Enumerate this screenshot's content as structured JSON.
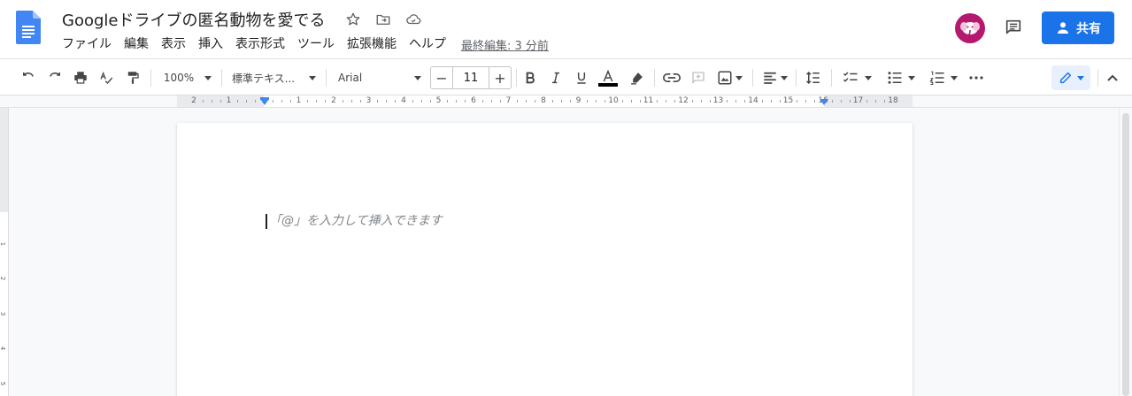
{
  "header": {
    "doc_title": "Googleドライブの匿名動物を愛でる",
    "menu": [
      "ファイル",
      "編集",
      "表示",
      "挿入",
      "表示形式",
      "ツール",
      "拡張機能",
      "ヘルプ"
    ],
    "last_edit": "最終編集: 3 分前",
    "share_label": "共有"
  },
  "toolbar": {
    "zoom": "100%",
    "style": "標準テキス...",
    "font": "Arial",
    "font_size": "11",
    "text_color": "#000000"
  },
  "ruler": {
    "labels": [
      "2",
      "1",
      "",
      "1",
      "2",
      "3",
      "4",
      "5",
      "6",
      "7",
      "8",
      "9",
      "10",
      "11",
      "12",
      "13",
      "14",
      "15",
      "16",
      "17",
      "18"
    ]
  },
  "vertical_ruler": {
    "labels": [
      "1",
      "2",
      "3",
      "4",
      "5"
    ]
  },
  "document": {
    "placeholder": "「@」を入力して挿入できます"
  },
  "colors": {
    "accent": "#1a73e8",
    "avatar_bg": "#b5186f",
    "indent_marker": "#4285f4"
  },
  "icons": [
    "docs-logo-icon",
    "star-icon",
    "move-to-folder-icon",
    "cloud-saved-icon",
    "avatar-elephant-icon",
    "comment-icon",
    "share-person-icon",
    "undo-icon",
    "redo-icon",
    "print-icon",
    "spellcheck-icon",
    "paint-format-icon",
    "bold-icon",
    "italic-icon",
    "underline-icon",
    "text-color-icon",
    "highlight-icon",
    "link-icon",
    "add-comment-icon",
    "insert-image-icon",
    "align-icon",
    "line-spacing-icon",
    "checklist-icon",
    "bulleted-list-icon",
    "numbered-list-icon",
    "more-icon",
    "edit-mode-icon",
    "collapse-icon"
  ]
}
